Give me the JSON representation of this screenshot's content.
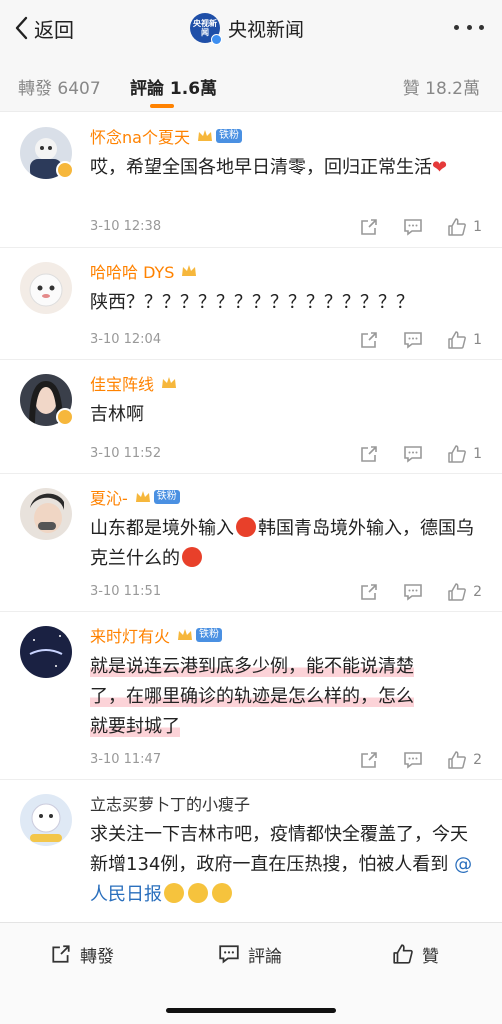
{
  "nav": {
    "back_label": "返回",
    "brand_name": "央视新闻",
    "brand_logo_text": "央视新闻"
  },
  "tabs": {
    "repost": "轉發 6407",
    "comments": "評論 1.6萬",
    "likes": "贊 18.2萬"
  },
  "colors": {
    "accent": "#ff8200",
    "highlight": "#fcd3d8",
    "link": "#2a6fbd",
    "fan_badge": "#4a90e2"
  },
  "comments": [
    {
      "user": "怀念na个夏天",
      "fan_badge": "铁粉",
      "text": "哎，希望全国各地早日清零，回归正常生活",
      "time": "3-10 12:38",
      "likes": "1"
    },
    {
      "user": "哈哈哈 DYS",
      "text": "陕西？？？？？？？？？？？？？？？？",
      "time": "3-10 12:04",
      "likes": "1"
    },
    {
      "user": "佳宝阵线",
      "text": "吉林啊",
      "time": "3-10 11:52",
      "likes": "1"
    },
    {
      "user": "夏沁-",
      "fan_badge": "铁粉",
      "text_a": "山东都是境外输入",
      "text_b": "韩国青岛境外输入，德国乌克兰什么的",
      "time": "3-10 11:51",
      "likes": "2"
    },
    {
      "user": "来时灯有火",
      "fan_badge": "铁粉",
      "line1": "就是说连云港到底多少例，能不能说清楚",
      "line2": "了，在哪里确诊的轨迹是怎么样的，怎么",
      "line3": "就要封城了",
      "time": "3-10 11:47",
      "likes": "2"
    },
    {
      "user": "立志买萝卜丁的小瘦子",
      "text": "求关注一下吉林市吧，疫情都快全覆盖了，今天新增134例，政府一直在压热搜，怕被人看到",
      "mention": "@人民日报"
    }
  ],
  "bottom": {
    "repost": "轉發",
    "comment": "評論",
    "like": "贊"
  }
}
